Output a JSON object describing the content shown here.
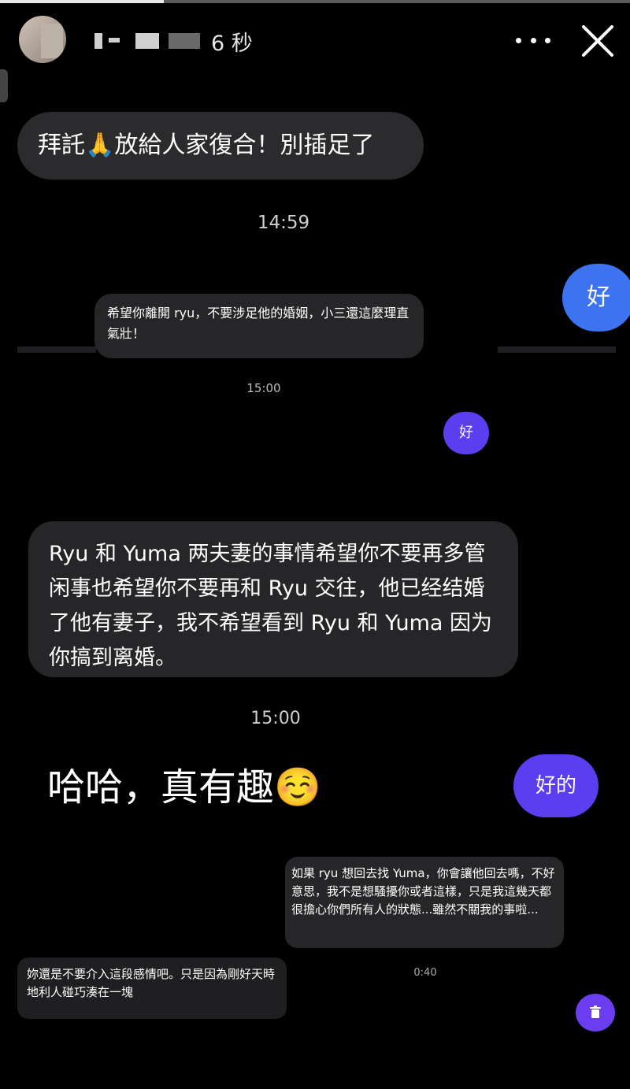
{
  "story": {
    "progress": 0.26,
    "time_label": "6 秒"
  },
  "messages": {
    "m1": "拜託🙏放給人家復合！別插足了",
    "time1": "14:59",
    "reply_blue": "好",
    "m2": "希望你離開 ryu，不要涉足他的婚姻，小三還這麼理直氣壯！",
    "time2": "15:00",
    "reply_purple_small": "好",
    "m3": "Ryu 和 Yuma 两夫妻的事情希望你不要再多管闲事也希望你不要再和 Ryu 交往，他已经结婚了他有妻子，我不希望看到 Ryu 和 Yuma 因为你搞到离婚。",
    "time3": "15:00",
    "caption": "哈哈，真有趣☺️",
    "reply_purple_large": "好的",
    "m4": "如果 ryu 想回去找 Yuma，你會讓他回去嗎，不好意思，我不是想騷擾你或者這樣，只是我這幾天都很擔心你們所有人的狀態...雖然不關我的事啦...",
    "time4": "0:40",
    "m5": "妳還是不要介入這段感情吧。只是因為剛好天時地利人碰巧湊在一塊"
  },
  "icons": {
    "more": "more-horizontal-icon",
    "close": "close-icon",
    "delete": "trash-icon"
  },
  "colors": {
    "bubble": "#2b2b2d",
    "blue": "#3d73f0",
    "purple": "#5b3ef0"
  }
}
